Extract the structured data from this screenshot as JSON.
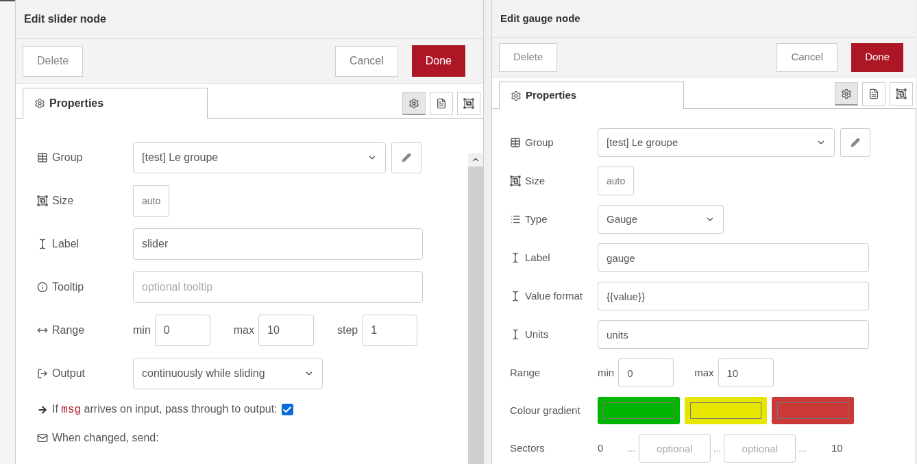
{
  "panels": [
    {
      "title": "Edit slider node",
      "delete": "Delete",
      "cancel": "Cancel",
      "done": "Done",
      "tab": {
        "label": "Properties",
        "selected": true
      },
      "side_tabs": [
        {
          "kind": "settings",
          "selected": true
        },
        {
          "kind": "description",
          "selected": false
        },
        {
          "kind": "appearance",
          "selected": false
        }
      ],
      "scrollbar": true,
      "rows": [
        {
          "kind": "group",
          "label": "Group",
          "value": "[test] Le groupe"
        },
        {
          "kind": "size",
          "label": "Size",
          "value": "auto"
        },
        {
          "kind": "label",
          "label": "Label",
          "value": "slider"
        },
        {
          "kind": "tooltip",
          "label": "Tooltip",
          "placeholder": "optional tooltip"
        },
        {
          "kind": "range",
          "label": "Range",
          "fields": [
            {
              "label": "min",
              "value": "0"
            },
            {
              "label": "max",
              "value": "10"
            },
            {
              "label": "step",
              "value": "1"
            }
          ]
        },
        {
          "kind": "output",
          "label": "Output",
          "value": "continuously while sliding"
        },
        {
          "kind": "passthrough",
          "before": "If",
          "code": "msg",
          "after": "arrives on input, pass through to output:",
          "checked": true
        },
        {
          "kind": "heading",
          "label": "When changed, send:"
        }
      ]
    },
    {
      "title": "Edit gauge node",
      "delete": "Delete",
      "cancel": "Cancel",
      "done": "Done",
      "tab": {
        "label": "Properties",
        "selected": true
      },
      "side_tabs": [
        {
          "kind": "settings",
          "selected": true
        },
        {
          "kind": "description",
          "selected": false
        },
        {
          "kind": "appearance",
          "selected": false
        }
      ],
      "scrollbar": false,
      "rows": [
        {
          "kind": "group",
          "label": "Group",
          "value": "[test] Le groupe"
        },
        {
          "kind": "size",
          "label": "Size",
          "value": "auto"
        },
        {
          "kind": "type",
          "label": "Type",
          "value": "Gauge"
        },
        {
          "kind": "label",
          "label": "Label",
          "value": "gauge"
        },
        {
          "kind": "label",
          "label": "Value format",
          "value": "{{value}}"
        },
        {
          "kind": "label",
          "label": "Units",
          "value": "units"
        },
        {
          "kind": "range-plain",
          "label": "Range",
          "fields": [
            {
              "label": "min",
              "value": "0"
            },
            {
              "label": "max",
              "value": "10"
            }
          ]
        },
        {
          "kind": "gradient",
          "label": "Colour gradient",
          "swatches": [
            {
              "color": "#00b400"
            },
            {
              "color": "#e6e600"
            },
            {
              "color": "#ca3838"
            }
          ]
        },
        {
          "kind": "sectors",
          "label": "Sectors",
          "start": "0",
          "separators": [
            "...",
            "...",
            "..."
          ],
          "placeholders": [
            "optional",
            "optional"
          ],
          "end": "10"
        }
      ]
    }
  ]
}
